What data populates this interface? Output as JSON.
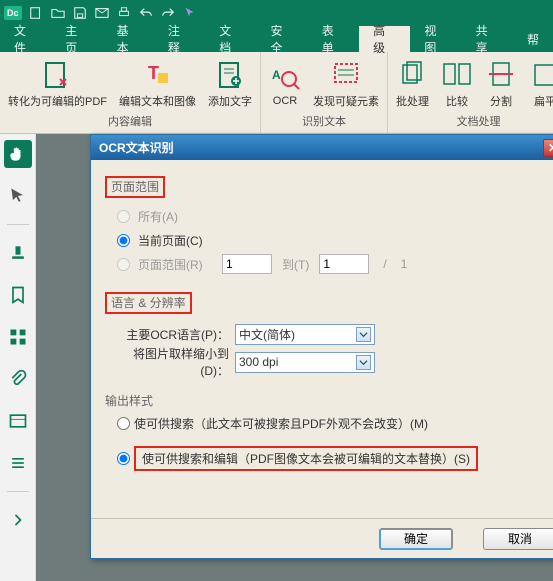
{
  "titlebar": {
    "app_tag": "Dc"
  },
  "menubar": {
    "items": [
      "文件",
      "主页",
      "基本",
      "注释",
      "文档",
      "安全",
      "表单",
      "高级",
      "视图",
      "共享",
      "帮"
    ],
    "active_index": 7
  },
  "ribbon": {
    "groups": [
      {
        "label": "内容编辑",
        "buttons": [
          {
            "name": "convert-editable-pdf",
            "caption": "转化为可编辑的PDF"
          },
          {
            "name": "edit-text-image",
            "caption": "编辑文本和图像"
          },
          {
            "name": "add-text",
            "caption": "添加文字"
          }
        ]
      },
      {
        "label": "识别文本",
        "buttons": [
          {
            "name": "ocr-button",
            "caption": "OCR"
          },
          {
            "name": "find-suspects",
            "caption": "发现可疑元素"
          }
        ]
      },
      {
        "label": "文档处理",
        "buttons": [
          {
            "name": "batch-process",
            "caption": "批处理"
          },
          {
            "name": "compare",
            "caption": "比较"
          },
          {
            "name": "split",
            "caption": "分割"
          },
          {
            "name": "flatten",
            "caption": "扁平"
          }
        ]
      }
    ]
  },
  "dialog": {
    "title": "OCR文本识别",
    "section_page_range": "页面范围",
    "opt_all": "所有(A)",
    "opt_current": "当前页面(C)",
    "opt_range": "页面范围(R)",
    "to_label": "到(T)",
    "range_from": "1",
    "range_to": "1",
    "slash": "/",
    "total_pages": "1",
    "section_lang": "语言 & 分辨率",
    "lang_label": "主要OCR语言(P)：",
    "lang_value": "中文(简体)",
    "dpi_label": "将图片取样缩小到(D)：",
    "dpi_value": "300 dpi",
    "section_output": "输出样式",
    "out_searchable": "使可供搜索（此文本可被搜索且PDF外观不会改变）(M)",
    "out_editable": "使可供搜索和编辑（PDF图像文本会被可编辑的文本替换）(S)",
    "ok": "确定",
    "cancel": "取消"
  }
}
